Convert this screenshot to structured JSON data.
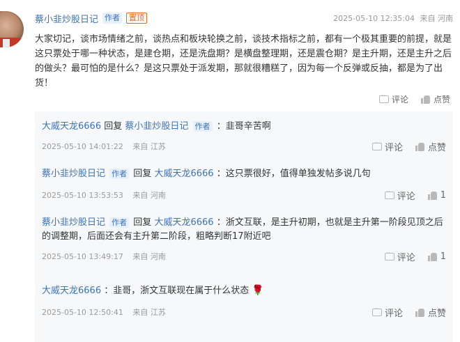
{
  "post": {
    "author": "蔡小韭炒股日记",
    "author_tag": "作者",
    "pin_tag": "置顶",
    "timestamp": "2025-05-10 12:35:04",
    "location": "来自 河南",
    "text": "大家切记，谈市场情绪之前，谈热点和板块轮换之前，谈技术指标之前，都有一个极其重要的前提，就是这只票处于哪一种状态，是建仓期，还是洗盘期？是横盘整理期，还是震仓期？是主升期，还是主升之后的做头？最可怕的是什么？是这只票处于派发期，那就很糟糕了，因为每一个反弹或反抽，都是为了出货！",
    "comment_label": "评论",
    "like_label": "点赞"
  },
  "replies": [
    {
      "from": "大威天龙6666",
      "from_is_author": false,
      "reply_word": "回复",
      "to": "蔡小韭炒股日记",
      "to_is_author": true,
      "content": "：韭哥辛苦啊",
      "timestamp": "2025-05-10 14:01:22",
      "location": "来自 江苏",
      "comment_label": "评论",
      "like_label": "点赞"
    },
    {
      "from": "蔡小韭炒股日记",
      "from_is_author": true,
      "reply_word": "回复",
      "to": "大威天龙6666",
      "to_is_author": false,
      "content": "：这只票很好，值得单独发帖多说几句",
      "timestamp": "2025-05-10 13:53:53",
      "location": "来自 河南",
      "comment_label": "评论",
      "like_label": "1"
    },
    {
      "from": "蔡小韭炒股日记",
      "from_is_author": true,
      "reply_word": "回复",
      "to": "大威天龙6666",
      "to_is_author": false,
      "content": "：浙文互联，是主升初期，也就是主升第一阶段见顶之后的调整期，后面还会有主升第二阶段，粗略判断17附近吧",
      "timestamp": "2025-05-10 13:49:17",
      "location": "来自 河南",
      "comment_label": "评论",
      "like_label": "1"
    },
    {
      "from": "大威天龙6666",
      "from_is_author": false,
      "content": "：韭哥，浙文互联现在属于什么状态",
      "emoji": "🌹",
      "timestamp": "2025-05-10 12:50:41",
      "location": "来自 江苏",
      "comment_label": "评论",
      "like_label": "点赞"
    }
  ],
  "author_tag": "作者",
  "colors": {
    "link": "#3b73b9",
    "pin": "#e36a1f",
    "panel": "#f7f8fa",
    "meta": "#999999"
  },
  "icons": [
    "comment-icon",
    "like-icon",
    "rose-emoji"
  ]
}
